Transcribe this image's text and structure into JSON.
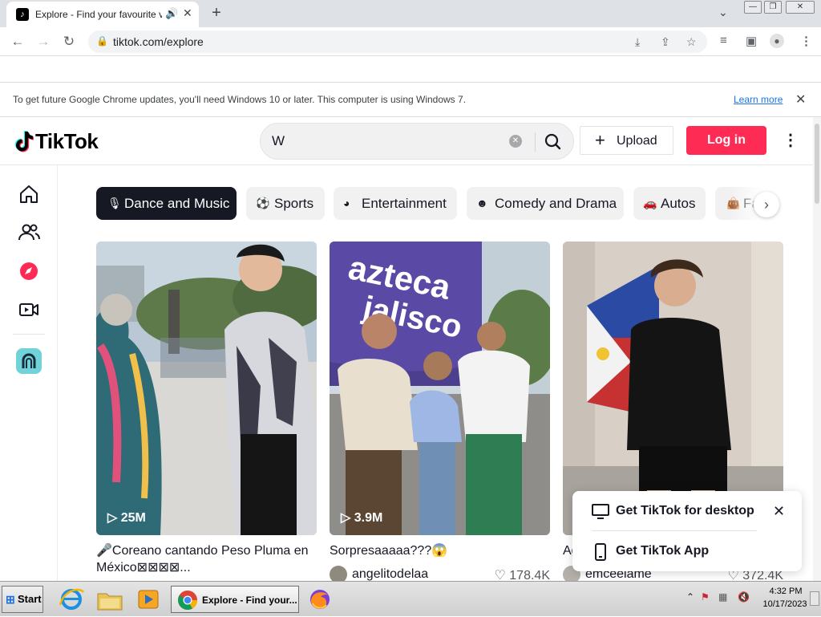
{
  "browser": {
    "tab_title": "Explore - Find your favourite vi",
    "tab_favicon": "tiktok-note",
    "url": "tiktok.com/explore",
    "infobar_message": "To get future Google Chrome updates, you'll need Windows 10 or later. This computer is using Windows 7.",
    "infobar_link": "Learn more"
  },
  "header": {
    "logo_text": "TikTok",
    "search_value": "W",
    "upload_label": "Upload",
    "login_label": "Log in"
  },
  "colors": {
    "accent": "#fe2c55",
    "dark": "#161823",
    "chip_bg": "#f1f1f2"
  },
  "categories": [
    {
      "label": "Dance and Music",
      "icon": "microphone-icon",
      "active": true
    },
    {
      "label": "Sports",
      "icon": "ball-icon",
      "active": false
    },
    {
      "label": "Entertainment",
      "icon": "masks-icon",
      "active": false
    },
    {
      "label": "Comedy and Drama",
      "icon": "smile-icon",
      "active": false
    },
    {
      "label": "Autos",
      "icon": "car-icon",
      "active": false
    },
    {
      "label": "Fa",
      "icon": "bag-icon",
      "active": false
    }
  ],
  "videos": [
    {
      "views": "25M",
      "description": "🎤Coreano cantando Peso Pluma en México⊠⊠⊠⊠...",
      "author": "",
      "likes": ""
    },
    {
      "views": "3.9M",
      "description": "Sorpresaaaaa???😱",
      "author": "angelitodelaa",
      "likes": "178.4K"
    },
    {
      "views": "",
      "description": "Ag",
      "author": "emceelame",
      "likes": "372.4K"
    }
  ],
  "popup": {
    "desktop_label": "Get TikTok for desktop",
    "app_label": "Get TikTok App"
  },
  "taskbar": {
    "start_label": "Start",
    "chrome_label": "Explore - Find your...",
    "time": "4:32 PM",
    "date": "10/17/2023"
  }
}
